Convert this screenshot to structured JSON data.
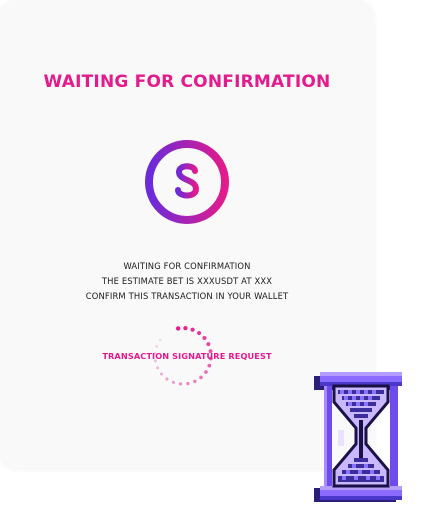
{
  "dialog": {
    "title": "WAITING FOR CONFIRMATION",
    "icon": "dollar-circle-icon",
    "message_lines": [
      "WAITING FOR CONFIRMATION",
      "THE ESTIMATE BET IS XXXUSDT AT XXX",
      "CONFIRM THIS TRANSACTION IN YOUR WALLET"
    ],
    "status_label": "TRANSACTION SIGNATURE REQUEST",
    "spinner_icon": "loading-spinner-icon",
    "decor_icon": "hourglass-icon"
  },
  "colors": {
    "accent_pink": "#e31b8c",
    "accent_purple": "#6a2bd9",
    "card_background": "#f9f9fa"
  }
}
